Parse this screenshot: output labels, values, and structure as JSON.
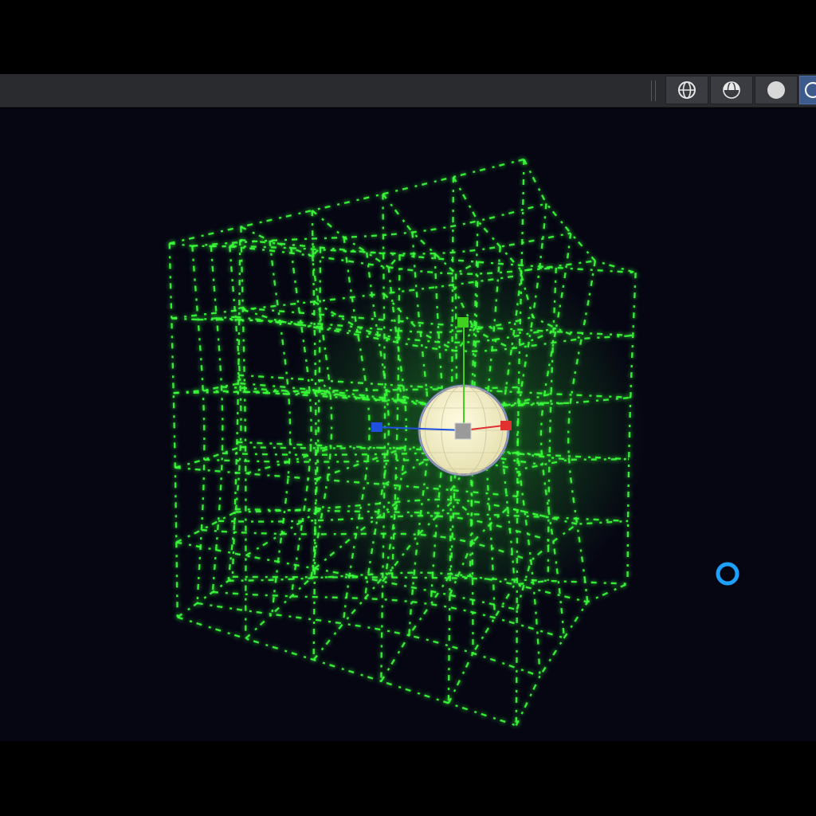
{
  "header": {
    "shading_modes": [
      {
        "name": "wireframe",
        "icon": "wireframe-sphere-icon",
        "active": false
      },
      {
        "name": "solid",
        "icon": "solid-sphere-icon",
        "active": false
      },
      {
        "name": "material-preview",
        "icon": "material-sphere-icon",
        "active": false
      },
      {
        "name": "rendered",
        "icon": "rendered-sphere-icon",
        "active": true
      }
    ]
  },
  "viewport": {
    "background_color": "#060613",
    "lattice_color": "#3bff3b",
    "gizmo_colors": {
      "x_axis": "#e03030",
      "y_axis": "#40d020",
      "z_axis": "#2050e0",
      "center": "#9a9a9a"
    },
    "sphere_color": "#f4f0cc",
    "cursor_ring_color": "#1ea0ff"
  }
}
